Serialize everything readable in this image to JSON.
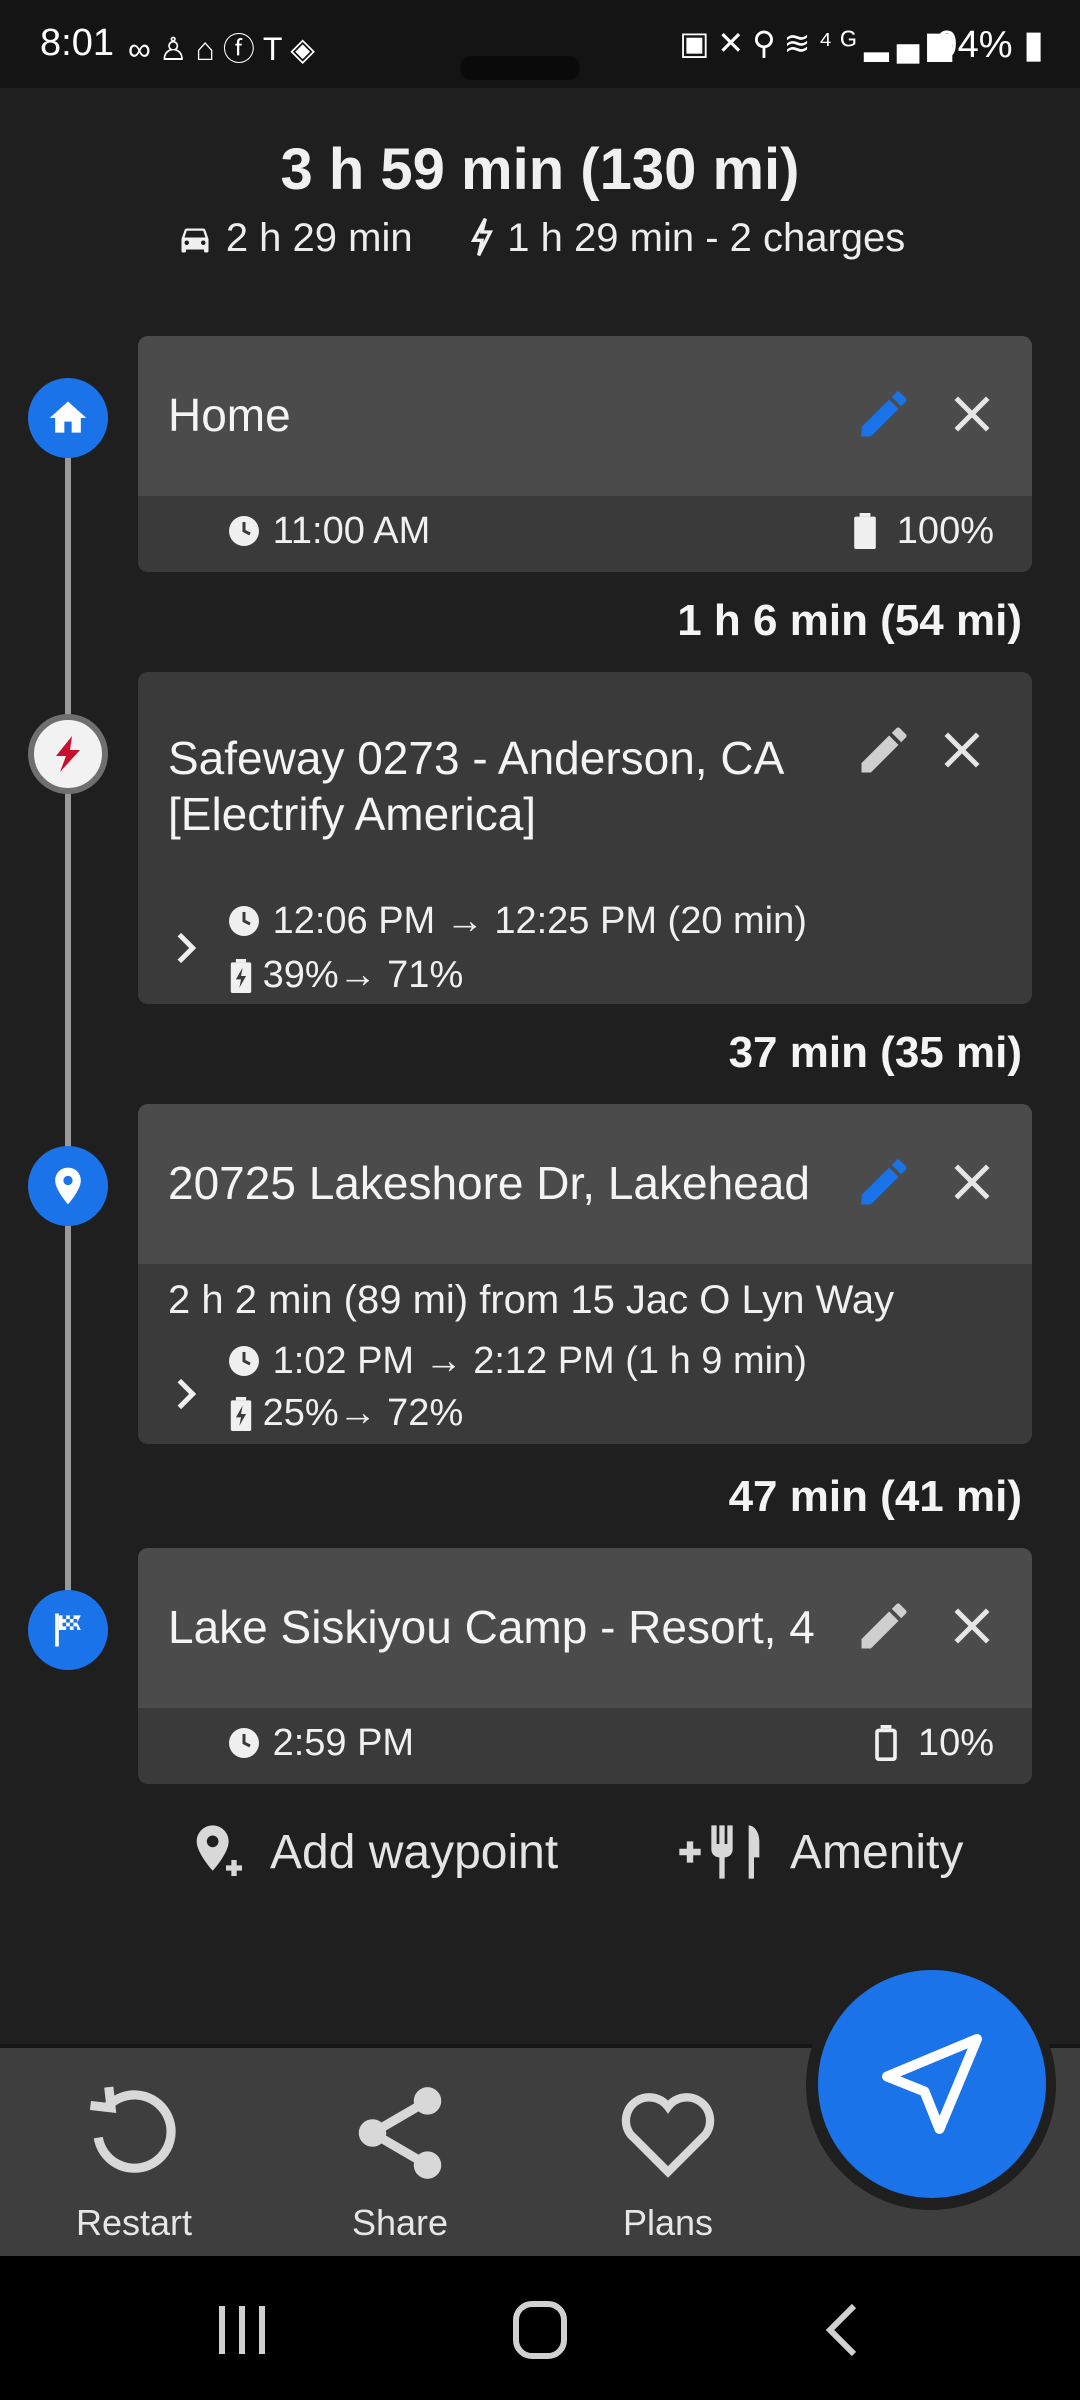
{
  "status_bar": {
    "time": "8:01",
    "left_icons": [
      "voicemail-icon",
      "person-icon",
      "home-icon",
      "facebook-icon",
      "tesla-icon",
      "diamond-icon"
    ],
    "right_icons": [
      "battery-saver-icon",
      "mute-icon",
      "location-icon",
      "wifi-icon",
      "4g-icon",
      "signal-icon"
    ],
    "battery": "94%"
  },
  "summary": {
    "title": "3 h 59 min (130 mi)",
    "drive_time": "2 h 29 min",
    "charge_time": "1 h 29 min - 2 charges"
  },
  "stops": [
    {
      "name": "Home",
      "type": "home",
      "edit_accent": "#1a73e8",
      "time": "11:00 AM",
      "battery": "100%"
    },
    {
      "name": "Safeway 0273 - Anderson, CA [Electrify America]",
      "type": "charger",
      "edit_accent": "#cfcfcf",
      "time": "12:06 PM → 12:25 PM (20 min)",
      "charge": "39%→ 71%"
    },
    {
      "name": "20725 Lakeshore Dr, Lakehead",
      "type": "waypoint",
      "edit_accent": "#1a73e8",
      "detour": "2 h 2 min (89 mi) from 15 Jac O Lyn Way",
      "time": "1:02 PM → 2:12 PM (1 h 9 min)",
      "charge": "25%→ 72%"
    },
    {
      "name": "Lake Siskiyou Camp - Resort, 4",
      "type": "destination",
      "edit_accent": "#cfcfcf",
      "time": "2:59 PM",
      "battery": "10%"
    }
  ],
  "legs": [
    "1 h 6 min (54 mi)",
    "37 min (35 mi)",
    "47 min (41 mi)"
  ],
  "actions": {
    "add_waypoint": "Add waypoint",
    "amenity": "Amenity"
  },
  "bottom_tabs": {
    "restart": "Restart",
    "share": "Share",
    "plans": "Plans"
  },
  "colors": {
    "accent": "#1a73e8",
    "background": "#1f1f1f",
    "card": "#3a3a3a",
    "card_header": "#4b4b4b"
  }
}
